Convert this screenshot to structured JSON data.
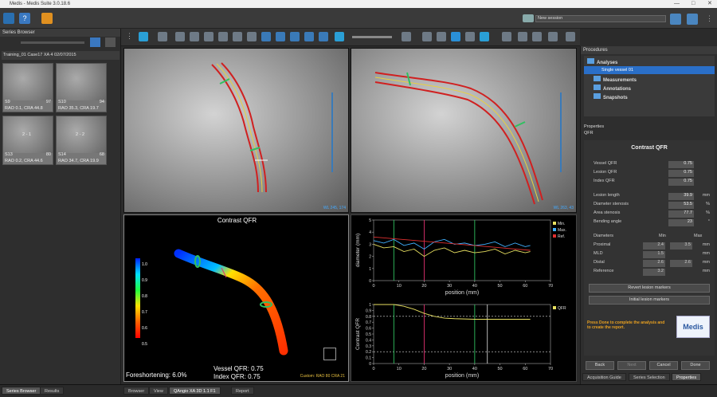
{
  "window": {
    "title": "Medis - Medis Suite 3.0.18.6"
  },
  "session": {
    "select_label": "New session"
  },
  "sidebar": {
    "header": "Series Browser",
    "patient_label": "Training_01 Case17 XA 4 02/07/2015",
    "thumbs": [
      {
        "num": "S9",
        "count": "97",
        "angles": "RAO 0.1, CRA 44.8",
        "label": ""
      },
      {
        "num": "S10",
        "count": "94",
        "angles": "RAO 35.3, CRA 19.7",
        "label": ""
      },
      {
        "num": "S13",
        "count": "80",
        "angles": "RAO 0.2, CRA 44.6",
        "label": "2 - 1"
      },
      {
        "num": "S14",
        "count": "68",
        "angles": "RAO 34.7, CRA 19.9",
        "label": "2 - 2"
      }
    ]
  },
  "viewers": {
    "left": {
      "wl": "WL 245, 174"
    },
    "right": {
      "wl": "WL 263, 43"
    }
  },
  "qfr3d": {
    "title": "Contrast QFR",
    "scale_labels": [
      "1.0",
      "0.9",
      "0.8",
      "0.7",
      "0.6",
      "0.5"
    ],
    "foreshortening": "Foreshortening: 6.0%",
    "vessel_qfr": "Vessel QFR: 0.75",
    "index_qfr": "Index QFR: 0.75",
    "custom_label": "Custom: RAO 80 CRA 21"
  },
  "chart_data": [
    {
      "type": "line",
      "title": "",
      "xlabel": "position (mm)",
      "ylabel": "diameter (mm)",
      "xlim": [
        0,
        70
      ],
      "ylim": [
        0,
        5
      ],
      "xticks": [
        0,
        10,
        20,
        30,
        40,
        50,
        60,
        70
      ],
      "yticks": [
        0,
        1,
        2,
        3,
        4,
        5
      ],
      "legend_position": "top-right",
      "series": [
        {
          "name": "Min.",
          "color": "#e8e060",
          "x": [
            0,
            4,
            8,
            12,
            16,
            20,
            24,
            28,
            32,
            36,
            40,
            44,
            48,
            52,
            56,
            60,
            62
          ],
          "values": [
            3.0,
            2.7,
            2.8,
            2.4,
            2.6,
            2.0,
            2.5,
            2.7,
            2.3,
            2.5,
            2.3,
            2.4,
            2.6,
            2.2,
            2.5,
            2.3,
            2.4
          ]
        },
        {
          "name": "Max.",
          "color": "#40b0ff",
          "x": [
            0,
            4,
            8,
            12,
            16,
            20,
            24,
            28,
            32,
            36,
            40,
            44,
            48,
            52,
            56,
            60,
            62
          ],
          "values": [
            3.3,
            3.1,
            3.4,
            2.9,
            3.1,
            2.6,
            3.2,
            3.4,
            3.0,
            3.1,
            2.9,
            3.0,
            3.2,
            2.8,
            3.1,
            2.8,
            2.9
          ]
        },
        {
          "name": "Ref.",
          "color": "#e03030",
          "x": [
            0,
            62
          ],
          "values": [
            3.6,
            2.5
          ]
        }
      ],
      "markers": [
        {
          "x": 8,
          "color": "#30c060"
        },
        {
          "x": 20,
          "color": "#e03070"
        },
        {
          "x": 40,
          "color": "#30c060"
        }
      ]
    },
    {
      "type": "line",
      "title": "",
      "xlabel": "position (mm)",
      "ylabel": "Contrast QFR",
      "xlim": [
        0,
        70
      ],
      "ylim": [
        0,
        1
      ],
      "xticks": [
        0,
        10,
        20,
        30,
        40,
        50,
        60,
        70
      ],
      "yticks": [
        0,
        0.1,
        0.2,
        0.3,
        0.4,
        0.5,
        0.6,
        0.7,
        0.8,
        0.9,
        1.0
      ],
      "legend_position": "top-right",
      "series": [
        {
          "name": "QFR",
          "color": "#e8e060",
          "x": [
            0,
            8,
            12,
            16,
            20,
            24,
            28,
            32,
            40,
            50,
            62
          ],
          "values": [
            1.0,
            1.0,
            0.97,
            0.92,
            0.85,
            0.8,
            0.77,
            0.76,
            0.75,
            0.75,
            0.75
          ]
        }
      ],
      "markers": [
        {
          "x": 8,
          "color": "#30c060"
        },
        {
          "x": 20,
          "color": "#e03070"
        },
        {
          "x": 40,
          "color": "#30c060"
        },
        {
          "x": 45,
          "color": "#cccccc"
        }
      ],
      "hlines": [
        0.2,
        0.8
      ]
    }
  ],
  "procedures": {
    "header": "Procedures",
    "items": [
      {
        "label": "Analyses"
      },
      {
        "label": "Single vessel 01"
      },
      {
        "label": "Measurements"
      },
      {
        "label": "Annotations"
      },
      {
        "label": "Snapshots"
      }
    ]
  },
  "properties": {
    "header": "Properties",
    "sub": "QFR",
    "title": "Contrast QFR",
    "rows1": [
      {
        "label": "Vessel QFR",
        "value": "0.75",
        "unit": ""
      },
      {
        "label": "Lesion QFR",
        "value": "0.75",
        "unit": ""
      },
      {
        "label": "Index QFR",
        "value": "0.75",
        "unit": ""
      }
    ],
    "rows2": [
      {
        "label": "Lesion length",
        "value": "39.9",
        "unit": "mm"
      },
      {
        "label": "Diameter stenosis",
        "value": "53.5",
        "unit": "%"
      },
      {
        "label": "Area stenosis",
        "value": "77.7",
        "unit": "%"
      },
      {
        "label": "Bending angle",
        "value": "23",
        "unit": "°"
      }
    ],
    "diam_header": {
      "label": "Diameters",
      "min": "Min",
      "max": "Max"
    },
    "diam_rows": [
      {
        "label": "Proximal",
        "min": "2.4",
        "max": "3.5",
        "unit": "mm"
      },
      {
        "label": "MLD",
        "min": "1.5",
        "max": "",
        "unit": "mm"
      },
      {
        "label": "Distal",
        "min": "2.6",
        "max": "2.6",
        "unit": "mm"
      },
      {
        "label": "Reference",
        "min": "3.2",
        "max": "",
        "unit": "mm"
      }
    ],
    "revert_btn": "Revert lesion markers",
    "initial_btn": "Initial lesion markers",
    "hint": "Press Done to complete the analysis and to create the report.",
    "logo": "Medis"
  },
  "nav": {
    "back": "Back",
    "next": "Next",
    "cancel": "Cancel",
    "done": "Done"
  },
  "right_tabs": [
    "Acquisition Guide",
    "Series Selection",
    "Properties"
  ],
  "bottom_tabs_left": [
    "Series Browser",
    "Results"
  ],
  "bottom_tabs_mid": [
    "Browser",
    "View",
    "QAngio XA 3D 1.1 F1",
    "Report"
  ]
}
